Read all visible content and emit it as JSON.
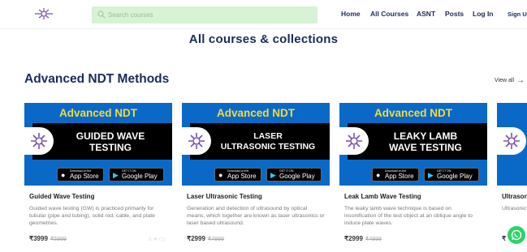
{
  "header": {
    "search_placeholder": "Search courses",
    "nav": [
      "Home",
      "All Courses",
      "ASNT",
      "Posts",
      "Log In",
      "Sign Up"
    ]
  },
  "page_title": "All courses & collections",
  "section": {
    "title": "Advanced NDT Methods",
    "view_all": "View all",
    "view_all_arrow": "→"
  },
  "cards": [
    {
      "banner_top": "Advanced NDT",
      "banner_main": "GUIDED WAVE\nTESTING",
      "store_apple_small": "Download on the",
      "store_apple": "App Store",
      "store_google_small": "GET IT ON",
      "store_google": "Google Play",
      "title": "Guided Wave Testing",
      "description": "Guided wave testing (GW) is practiced primarily for tubular (pipe and tubing), solid rod, cable, and plate geometries.",
      "price": "₹3999",
      "old_price": "₹5999",
      "rating": "5 ★ (1)"
    },
    {
      "banner_top": "Advanced NDT",
      "banner_main": "LASER\nULTRASONIC TESTING",
      "store_apple_small": "Download on the",
      "store_apple": "App Store",
      "store_google_small": "GET IT ON",
      "store_google": "Google Play",
      "title": "Laser Ultrasonic Testing",
      "description": "Generation and detection of ultrasound by optical means, which together are known as laser ultrasonics or laser based ultrasound.",
      "price": "₹2999",
      "old_price": "₹4999",
      "rating": ""
    },
    {
      "banner_top": "Advanced NDT",
      "banner_main": "LEAKY LAMB\nWAVE TESTING",
      "store_apple_small": "Download on the",
      "store_apple": "App Store",
      "store_google_small": "GET IT ON",
      "store_google": "Google Play",
      "title": "Leak Lamb Wave Testing",
      "description": "The leaky lamb wave technique is based on insonification of the test object at an oblique angle to induce plate waves.",
      "price": "₹2999",
      "old_price": "₹4999",
      "rating": ""
    },
    {
      "banner_top": "",
      "banner_main": "",
      "title": "Ultrasonic",
      "description": "Ultrasonic useful fo",
      "price": "₹",
      "old_price": ""
    }
  ],
  "colors": {
    "brand_navy": "#1a2b5f",
    "banner_blue": "#0a69c7",
    "banner_yellow": "#f6d93b",
    "search_bg": "#d7f2d5",
    "whatsapp": "#2dd266"
  },
  "icons": {
    "logo": "ndt-logo-icon",
    "search": "search-icon",
    "whatsapp": "whatsapp-icon",
    "apple": "apple-icon",
    "google_play": "google-play-icon"
  }
}
